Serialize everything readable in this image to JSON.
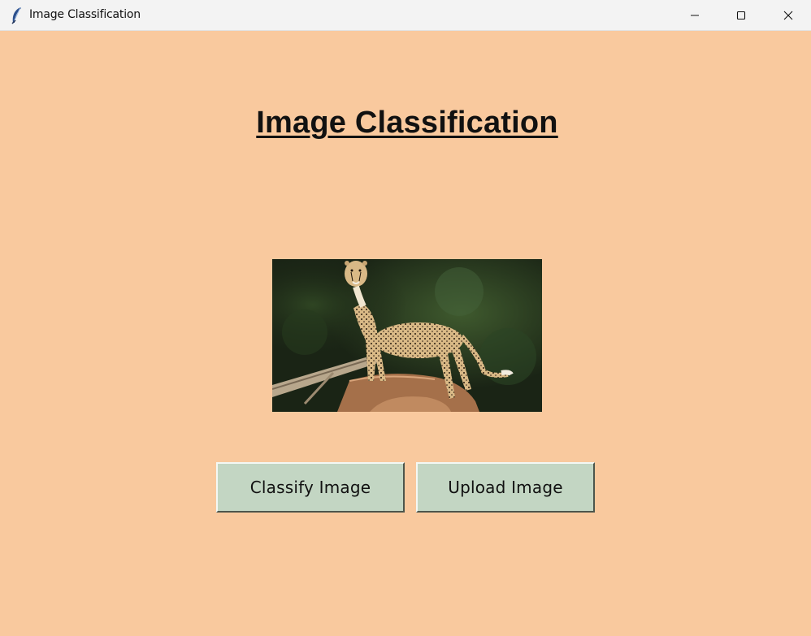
{
  "window": {
    "title": "Image Classification",
    "controls": [
      "minimize-icon",
      "maximize-icon",
      "close-icon"
    ]
  },
  "main": {
    "heading": "Image Classification",
    "image_subject": "cheetah",
    "buttons": {
      "classify_label": "Classify Image",
      "upload_label": "Upload Image"
    }
  },
  "colors": {
    "background": "#f9c99e",
    "button": "#c3d6c3",
    "titlebar": "#f3f3f3"
  }
}
